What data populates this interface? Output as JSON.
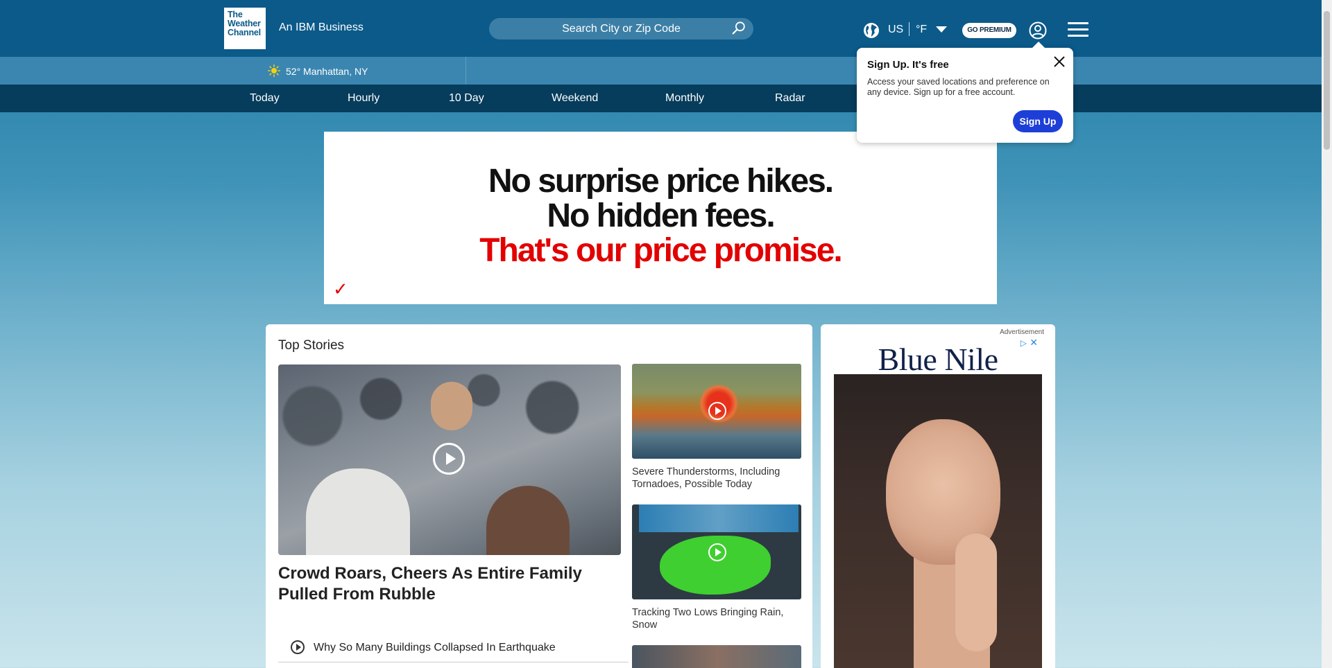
{
  "header": {
    "logo_lines": [
      "The",
      "Weather",
      "Channel"
    ],
    "tagline": "An IBM Business",
    "search_placeholder": "Search City or Zip Code",
    "region": "US",
    "unit": "°F",
    "premium_label": "GO PREMIUM"
  },
  "location": {
    "text": "52° Manhattan, NY"
  },
  "nav": {
    "items": [
      "Today",
      "Hourly",
      "10 Day",
      "Weekend",
      "Monthly",
      "Radar"
    ]
  },
  "ad_banner": {
    "line1": "No surprise price hikes.",
    "line2": "No hidden fees.",
    "line3": "That's our price promise.",
    "mark": "✓"
  },
  "top_stories": {
    "heading": "Top Stories",
    "main_title": "Crowd Roars, Cheers As Entire Family Pulled From Rubble",
    "sub_link": "Why So Many Buildings Collapsed In Earthquake",
    "side": [
      "Severe Thunderstorms, Including Tornadoes, Possible Today",
      "Tracking Two Lows Bringing Rain, Snow"
    ]
  },
  "side_ad": {
    "label": "Advertisement",
    "brand": "Blue Nile"
  },
  "popup": {
    "title": "Sign Up. It's free",
    "description": "Access your saved locations and preference on any device. Sign up for a free account.",
    "button": "Sign Up"
  },
  "colors": {
    "header_bg": "#0b5a8a",
    "nav_bg": "#063c5c",
    "signup_button": "#1d3fd8",
    "ad_accent": "#e20000"
  }
}
